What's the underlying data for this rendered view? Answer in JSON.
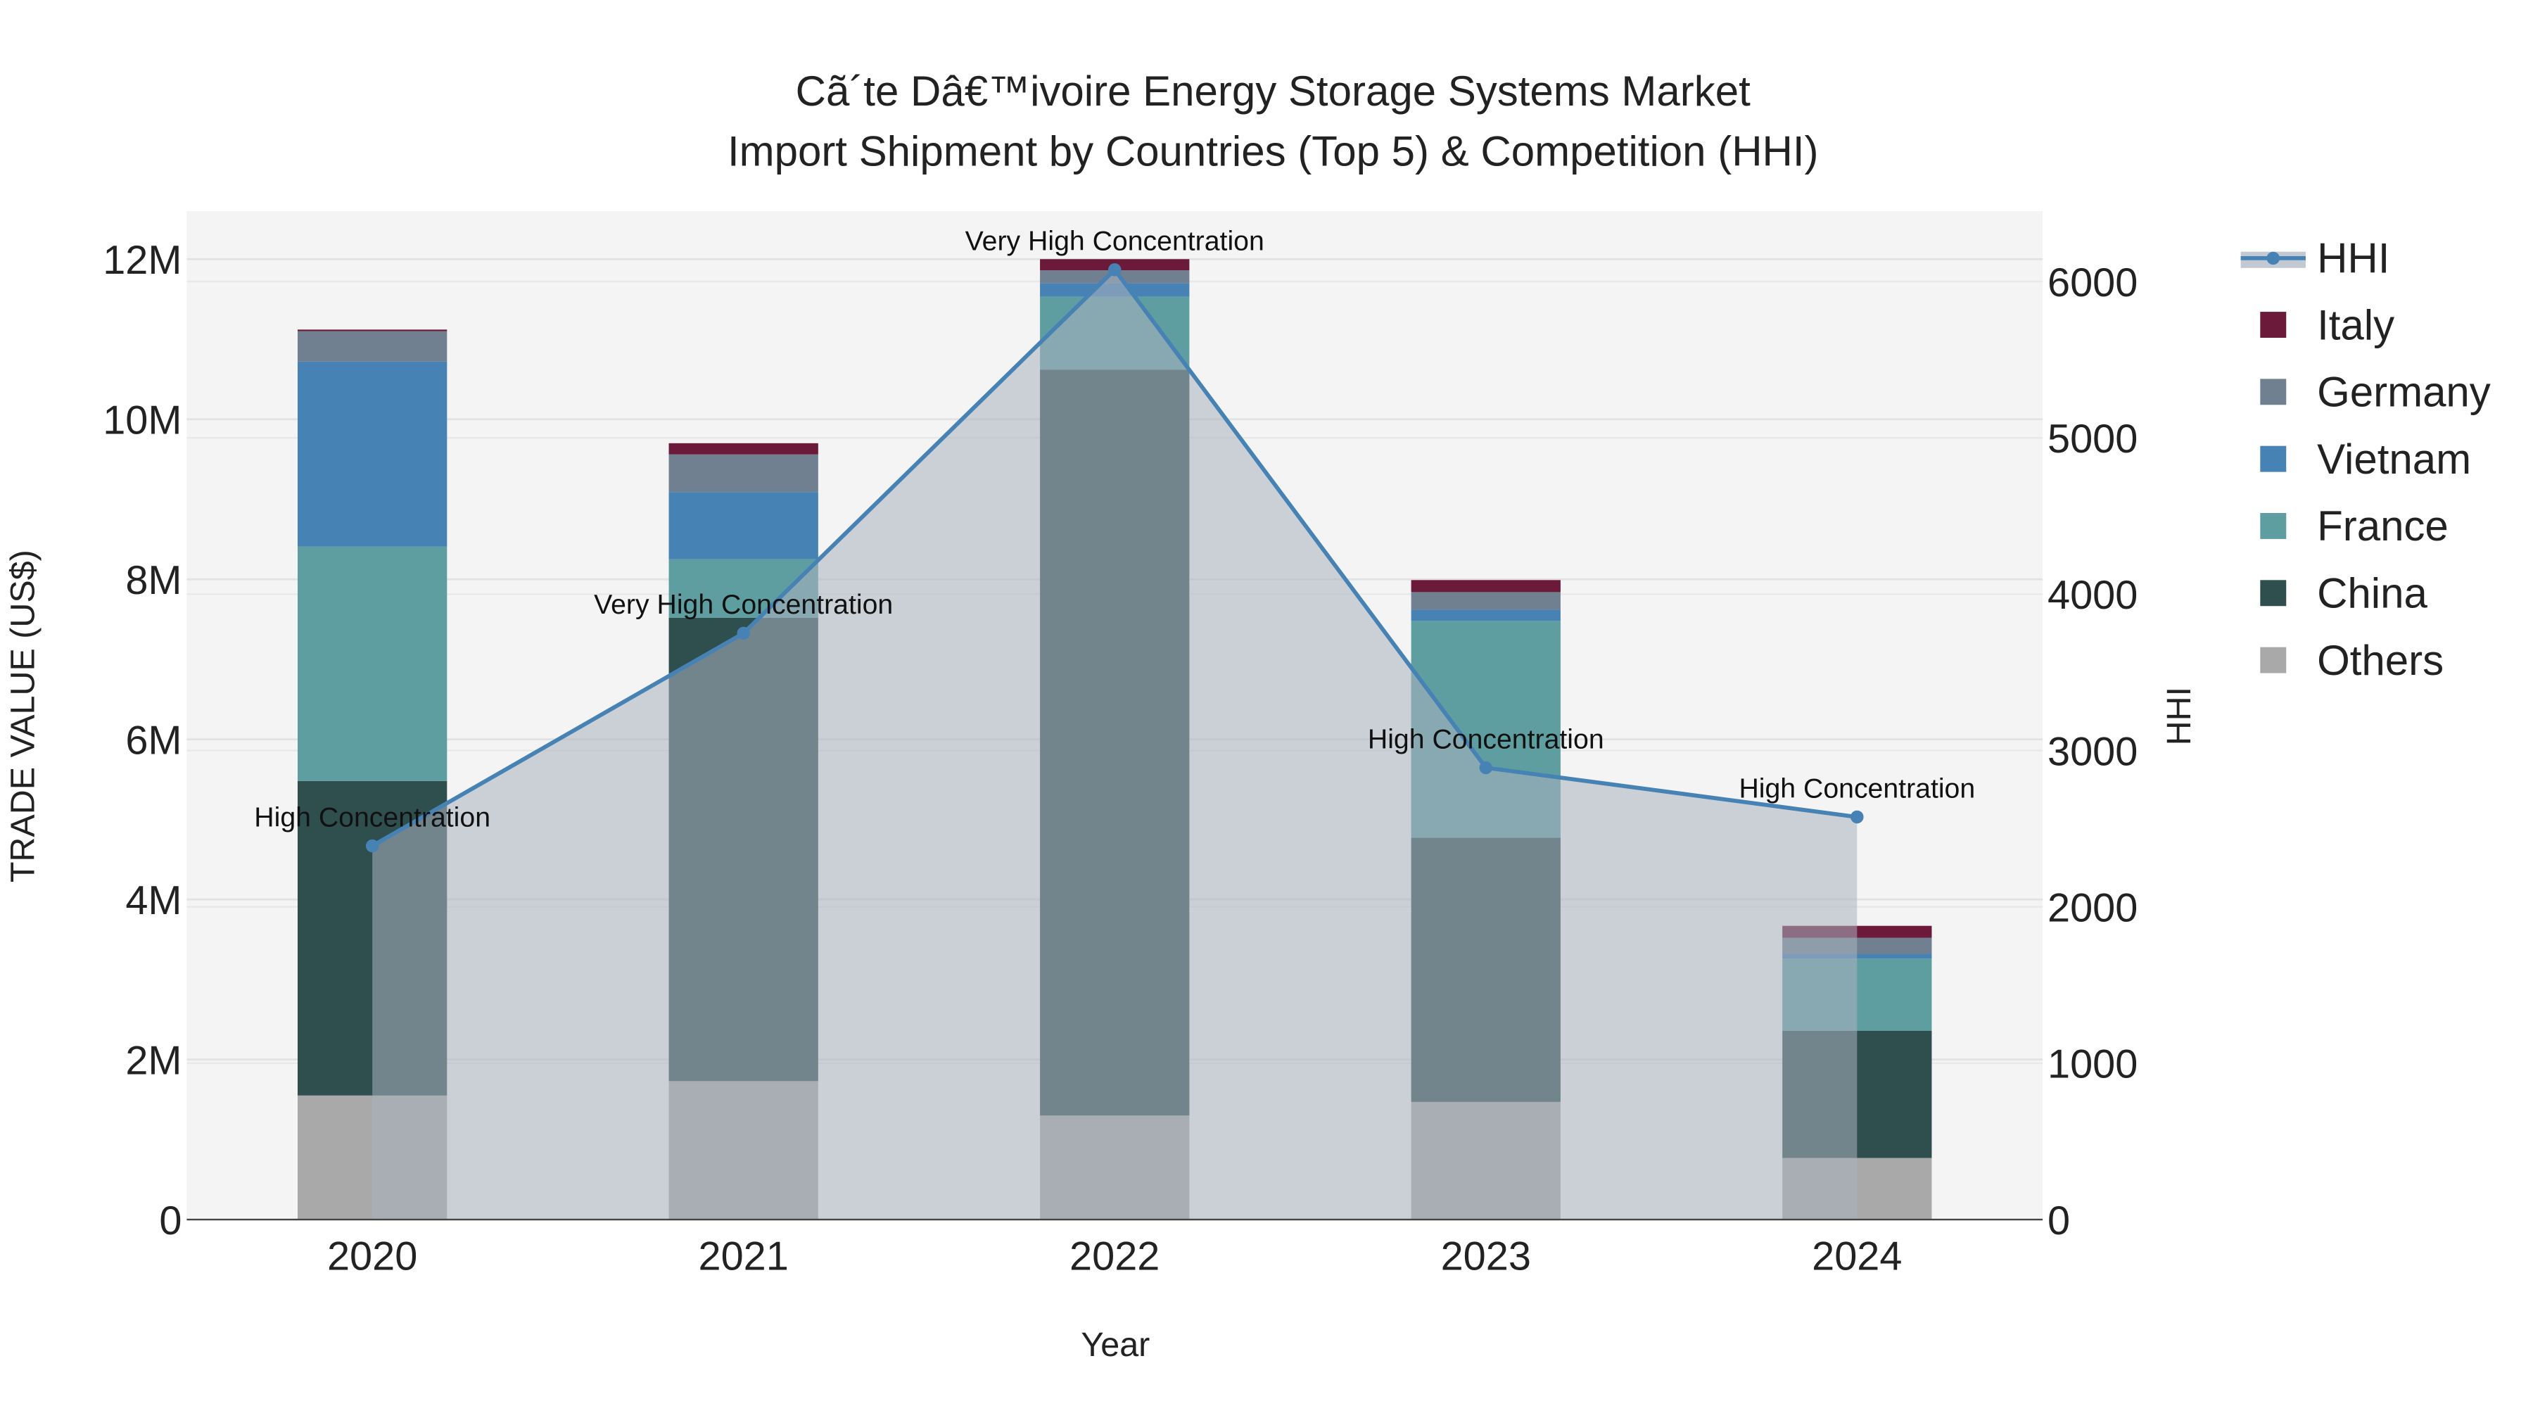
{
  "chart_data": {
    "type": "bar",
    "title": "Cã´te Dâ€™ivoire Energy Storage Systems Market",
    "subtitle": "Import Shipment by Countries (Top 5) & Competition (HHI)",
    "xlabel": "Year",
    "ylabel": "TRADE VALUE (US$)",
    "y2label": "HHI",
    "categories": [
      "2020",
      "2021",
      "2022",
      "2023",
      "2024"
    ],
    "ylim": [
      0,
      12.6
    ],
    "y2lim": [
      0,
      6450
    ],
    "yticks": [
      {
        "v": 0,
        "label": "0"
      },
      {
        "v": 2,
        "label": "2M"
      },
      {
        "v": 4,
        "label": "4M"
      },
      {
        "v": 6,
        "label": "6M"
      },
      {
        "v": 8,
        "label": "8M"
      },
      {
        "v": 10,
        "label": "10M"
      },
      {
        "v": 12,
        "label": "12M"
      }
    ],
    "y2ticks": [
      {
        "v": 0,
        "label": "0"
      },
      {
        "v": 1000,
        "label": "1000"
      },
      {
        "v": 2000,
        "label": "2000"
      },
      {
        "v": 3000,
        "label": "3000"
      },
      {
        "v": 4000,
        "label": "4000"
      },
      {
        "v": 5000,
        "label": "5000"
      },
      {
        "v": 6000,
        "label": "6000"
      }
    ],
    "value_unit": "US$ millions",
    "series": [
      {
        "name": "Others",
        "color": "#a9a9a9",
        "values": [
          1.55,
          1.73,
          1.3,
          1.47,
          0.77
        ]
      },
      {
        "name": "China",
        "color": "#2f4f4f",
        "values": [
          3.93,
          5.79,
          9.32,
          3.3,
          1.59
        ]
      },
      {
        "name": "France",
        "color": "#5f9ea0",
        "values": [
          2.93,
          0.73,
          0.91,
          2.71,
          0.9
        ]
      },
      {
        "name": "Vietnam",
        "color": "#4682b4",
        "values": [
          2.31,
          0.84,
          0.17,
          0.14,
          0.06
        ]
      },
      {
        "name": "Germany",
        "color": "#708090",
        "values": [
          0.38,
          0.47,
          0.16,
          0.22,
          0.2
        ]
      },
      {
        "name": "Italy",
        "color": "#6b1a3a",
        "values": [
          0.02,
          0.14,
          0.14,
          0.15,
          0.15
        ]
      }
    ],
    "hhi": {
      "name": "HHI",
      "color": "#4682b4",
      "values": [
        2390,
        3750,
        6075,
        2890,
        2575
      ],
      "annotations": [
        "High Concentration",
        "Very High Concentration",
        "Very High Concentration",
        "High Concentration",
        "High Concentration"
      ]
    },
    "legend": [
      "HHI",
      "Italy",
      "Germany",
      "Vietnam",
      "France",
      "China",
      "Others"
    ],
    "legend_position": "right",
    "grid": true
  }
}
